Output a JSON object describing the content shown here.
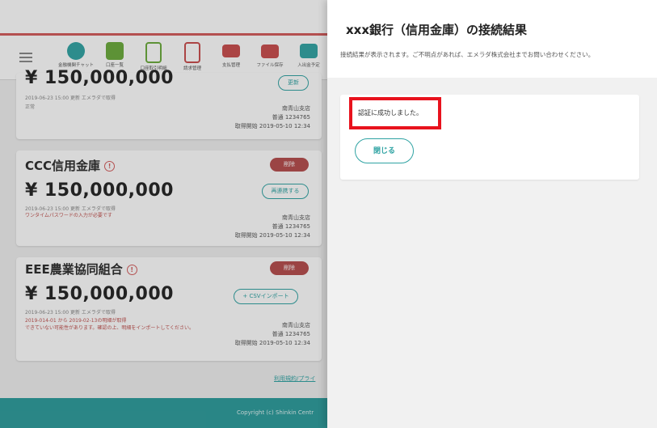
{
  "toolbar": {
    "items": [
      {
        "label": "金融機関チャット",
        "icon": "chat-icon",
        "color": "#2fa3a3"
      },
      {
        "label": "口座一覧",
        "icon": "account-list-icon",
        "color": "#6aaa3a"
      },
      {
        "label": "口座取引明細",
        "icon": "document-icon",
        "color": "#6aaa3a"
      },
      {
        "label": "請求管理",
        "icon": "invoice-icon",
        "color": "#c84b4b"
      },
      {
        "label": "支払管理",
        "icon": "card-icon",
        "color": "#c84b4b"
      },
      {
        "label": "ファイル保存",
        "icon": "folder-icon",
        "color": "#c84b4b"
      },
      {
        "label": "入出金予定",
        "icon": "calendar-icon",
        "color": "#2fa3a3"
      }
    ]
  },
  "accounts": [
    {
      "amount": "¥ 150,000,000",
      "updated": "2019-06-23 15:00 更新 エメラダで取得",
      "status": "正常",
      "branch": "南青山支店",
      "account": "普通 1234765",
      "start": "取得開始 2019-05-10 12:34",
      "action": "更新"
    },
    {
      "name": "CCC信用金庫",
      "amount": "¥ 150,000,000",
      "updated": "2019-06-23 15:00 更新 エメラダで取得",
      "warning": "ワンタイムパスワードの入力が必要です",
      "branch": "南青山支店",
      "account": "普通 1234765",
      "start": "取得開始 2019-05-10 12:34",
      "delete": "削除",
      "action": "再連携する"
    },
    {
      "name": "EEE農業協同組合",
      "amount": "¥ 150,000,000",
      "updated": "2019-06-23 15:00 更新 エメラダで取得",
      "warning1": "2019-014-01 から 2019-02-13の明細が取得",
      "warning2": "できていない可能性があります。確認の上、明細をインポートしてください。",
      "branch": "南青山支店",
      "account": "普通 1234765",
      "start": "取得開始 2019-05-10 12:34",
      "delete": "削除",
      "action": "+ CSVインポート"
    }
  ],
  "footer": {
    "link": "利用規約/プライ",
    "copyright": "Copyright (c) Shinkin Centr"
  },
  "panel": {
    "title": "xxx銀行（信用金庫）の接続結果",
    "description": "接続結果が表示されます。ご不明点があれば、エメラダ株式会社までお問い合わせください。",
    "success_message": "認証に成功しました。",
    "close_label": "閉じる"
  },
  "colors": {
    "accent": "#2fa3a3",
    "danger": "#b54b4b",
    "highlight": "#e8121d"
  }
}
